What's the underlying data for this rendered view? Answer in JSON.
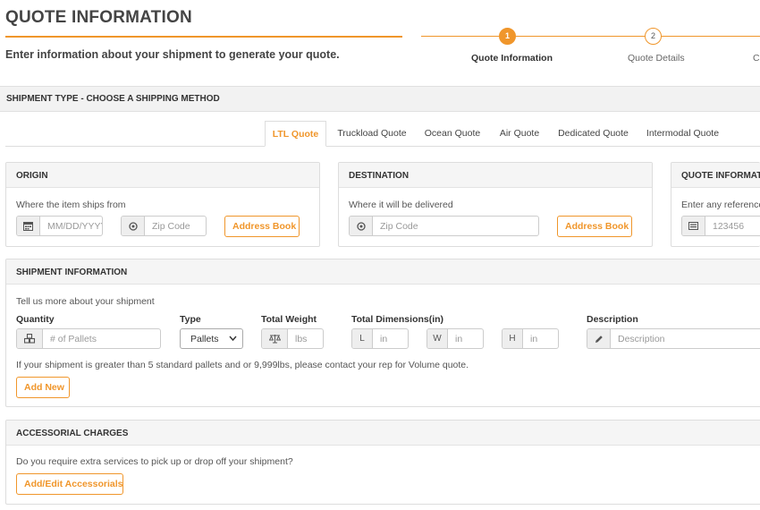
{
  "header": {
    "title": "QUOTE INFORMATION",
    "subtitle": "Enter information about your shipment to generate your quote."
  },
  "stepper": {
    "steps": [
      {
        "number": "1",
        "label": "Quote Information",
        "state": "active"
      },
      {
        "number": "2",
        "label": "Quote Details",
        "state": "todo"
      },
      {
        "label": "Co"
      }
    ]
  },
  "shipment_type": {
    "label": "SHIPMENT TYPE - CHOOSE A SHIPPING METHOD",
    "tabs": [
      {
        "label": "LTL Quote",
        "active": true
      },
      {
        "label": "Truckload Quote"
      },
      {
        "label": "Ocean Quote"
      },
      {
        "label": "Air Quote"
      },
      {
        "label": "Dedicated Quote"
      },
      {
        "label": "Intermodal Quote"
      }
    ]
  },
  "origin": {
    "title": "ORIGIN",
    "hint": "Where the item ships from",
    "date_placeholder": "MM/DD/YYYY",
    "zip_placeholder": "Zip Code",
    "address_book_label": "Address Book"
  },
  "destination": {
    "title": "DESTINATION",
    "hint": "Where it will be delivered",
    "zip_placeholder": "Zip Code",
    "address_book_label": "Address Book"
  },
  "quote_info": {
    "title": "QUOTE INFORMATION",
    "hint": "Enter any reference numbers",
    "reference_placeholder": "123456"
  },
  "shipment_info": {
    "title": "SHIPMENT INFORMATION",
    "hint": "Tell us more about your shipment",
    "quantity_label": "Quantity",
    "quantity_placeholder": "# of Pallets",
    "type_label": "Type",
    "type_selected": "Pallets",
    "weight_label": "Total Weight",
    "weight_placeholder": "lbs",
    "dimensions_label": "Total Dimensions(in)",
    "length_addon": "L",
    "width_addon": "W",
    "height_addon": "H",
    "dimension_placeholder": "in",
    "description_label": "Description",
    "description_placeholder": "Description",
    "volume_note": "If your shipment is greater than 5 standard pallets and or 9,999lbs, please contact your rep for Volume quote.",
    "add_new_label": "Add New"
  },
  "accessorial": {
    "title": "ACCESSORIAL CHARGES",
    "hint": "Do you require extra services to pick up or drop off your shipment?",
    "button_label": "Add/Edit Accessorials"
  },
  "colors": {
    "accent": "#f0962b",
    "panel_header": "#f5f5f5",
    "border": "#dddddd"
  },
  "icons": {
    "date": "calendar-icon",
    "zip": "location-pin-icon",
    "reference": "id-card-icon",
    "quantity": "cubes-icon",
    "weight": "scale-icon",
    "description": "pencil-icon"
  }
}
